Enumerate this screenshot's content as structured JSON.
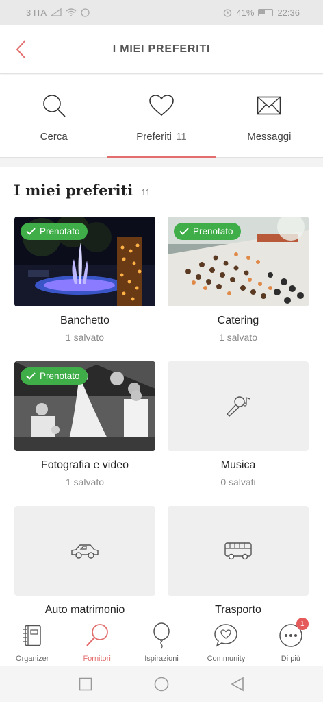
{
  "status_bar": {
    "carrier": "3 ITA",
    "battery": "41%",
    "time": "22:36"
  },
  "header": {
    "title": "I MIEI PREFERITI"
  },
  "tabs": [
    {
      "label": "Cerca",
      "icon": "search-icon"
    },
    {
      "label": "Preferiti",
      "count": "11",
      "icon": "heart-icon",
      "active": true
    },
    {
      "label": "Messaggi",
      "icon": "envelope-icon"
    }
  ],
  "section": {
    "title": "I miei preferiti",
    "count": "11"
  },
  "badge_label": "Prenotato",
  "cards": [
    {
      "name": "Banchetto",
      "sub": "1 salvato",
      "booked": true,
      "image": "venue-night-fountain"
    },
    {
      "name": "Catering",
      "sub": "1 salvato",
      "booked": true,
      "image": "catering-buffet"
    },
    {
      "name": "Fotografia e video",
      "sub": "1 salvato",
      "booked": true,
      "image": "wedding-photo-bw"
    },
    {
      "name": "Musica",
      "sub": "0 salvati",
      "booked": false,
      "icon": "microphone-icon"
    },
    {
      "name": "Auto matrimonio",
      "sub": "",
      "booked": false,
      "icon": "car-icon"
    },
    {
      "name": "Trasporto",
      "sub": "",
      "booked": false,
      "icon": "bus-icon"
    }
  ],
  "bottom_nav": [
    {
      "label": "Organizer",
      "icon": "notebook-icon"
    },
    {
      "label": "Fornitori",
      "icon": "magnifier-icon",
      "active": true
    },
    {
      "label": "Ispirazioni",
      "icon": "balloon-icon"
    },
    {
      "label": "Community",
      "icon": "chat-heart-icon"
    },
    {
      "label": "Di più",
      "icon": "more-dots-icon",
      "badge": "1"
    }
  ],
  "colors": {
    "accent": "#e26e6e",
    "badge_green": "#3fae49",
    "notification": "#e55a5a"
  }
}
